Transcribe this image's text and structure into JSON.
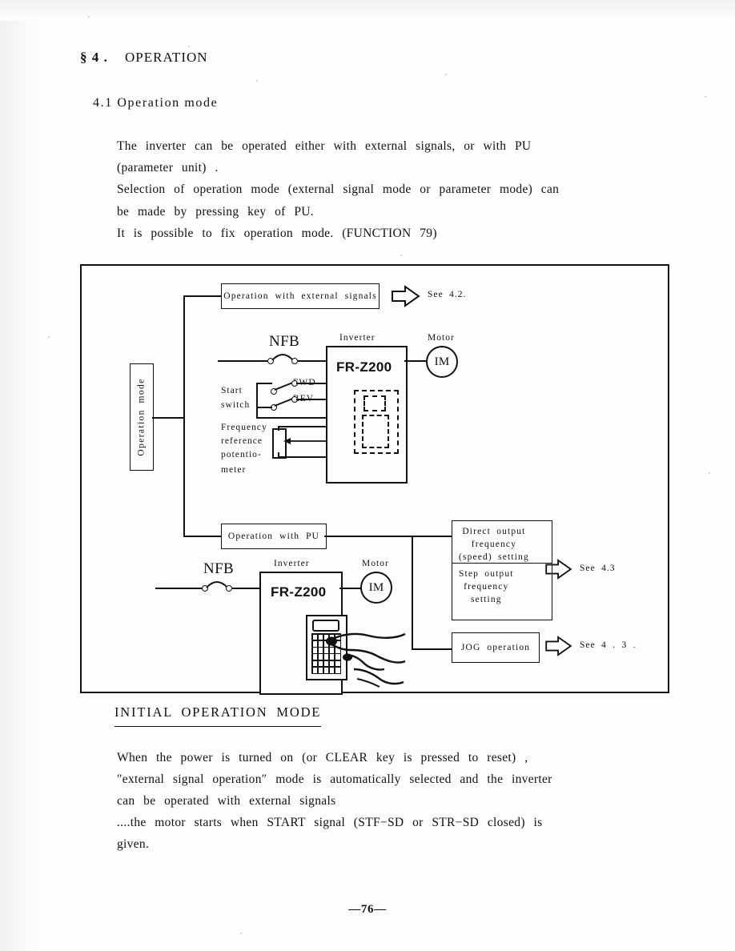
{
  "document": {
    "section_number": "§ 4 .",
    "section_title": "OPERATION",
    "subsection": "4.1  Operation  mode",
    "page_number": "—76—"
  },
  "intro_paragraph": [
    "The  inverter  can  be  operated  either  with  external  signals, or  with  PU",
    " (parameter  unit) .",
    "Selection  of  operation  mode (external  signal  mode  or  parameter  mode) can",
    "be  made  by  pressing  key  of  PU.",
    "It  is  possible  to  fix  operation  mode. (FUNCTION  79)"
  ],
  "diagram": {
    "mode_selector_label": "Operation  mode",
    "branch_external": {
      "box_label": "Operation  with  external  signals",
      "see_reference": "See  4.2.",
      "breaker_label": "NFB",
      "inverter_caption": "Inverter",
      "inverter_model": "FR-Z200",
      "motor_caption": "Motor",
      "motor_symbol": "IM",
      "start_switch_label_line1": "Start",
      "start_switch_label_line2": "switch",
      "fwd_label": "FWD",
      "rev_label": "REV",
      "frequency_label_line1": "Frequency",
      "frequency_label_line2": "reference",
      "frequency_label_line3": "potentio-",
      "frequency_label_line4": "meter"
    },
    "branch_pu": {
      "box_label": "Operation  with  PU",
      "breaker_label": "NFB",
      "inverter_caption": "Inverter",
      "inverter_model": "FR-Z200",
      "motor_caption": "Motor",
      "motor_symbol": "IM",
      "outputs": [
        {
          "lines": [
            "Direct  output",
            "frequency",
            "(speed)  setting"
          ],
          "see_reference": "See  4.3"
        },
        {
          "lines": [
            "Step  output",
            "frequency",
            "setting"
          ],
          "see_reference": ""
        },
        {
          "lines": [
            "JOG  operation"
          ],
          "see_reference": "See  4 . 3 ."
        }
      ]
    }
  },
  "initial_mode": {
    "heading": "INITIAL  OPERATION  MODE",
    "paragraph": [
      "When  the  power  is  turned  on (or  CLEAR  key  is  pressed  to  reset) ,",
      " ″external  signal  operation″ mode  is  automatically  selected  and  the  inverter",
      "can  be  operated  with  external  signals",
      "....the  motor  starts  when  START  signal (STF−SD  or  STR−SD  closed) is",
      "given."
    ]
  }
}
